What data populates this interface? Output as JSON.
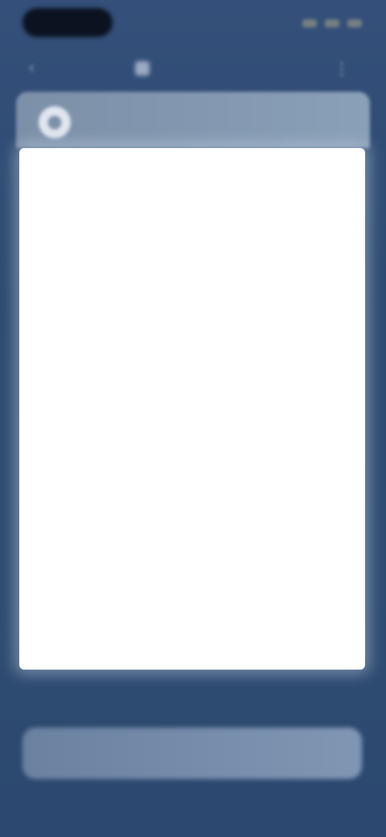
{
  "status_bar": {
    "time": "",
    "icons": [
      "signal-icon",
      "wifi-icon",
      "battery-icon"
    ]
  },
  "nav": {
    "back_icon": "back-arrow-icon",
    "title": "",
    "title_icon": "app-icon",
    "menu_icon": "menu-icon"
  },
  "card": {
    "avatar_icon": "avatar-icon",
    "side_label": "",
    "center_title": "",
    "center_subtitle": ""
  },
  "action": {
    "label": ""
  },
  "colors": {
    "background": "#2f4b70",
    "card_header": "#7c90a8",
    "card_body": "#ffffff",
    "button": "#7189a6"
  }
}
